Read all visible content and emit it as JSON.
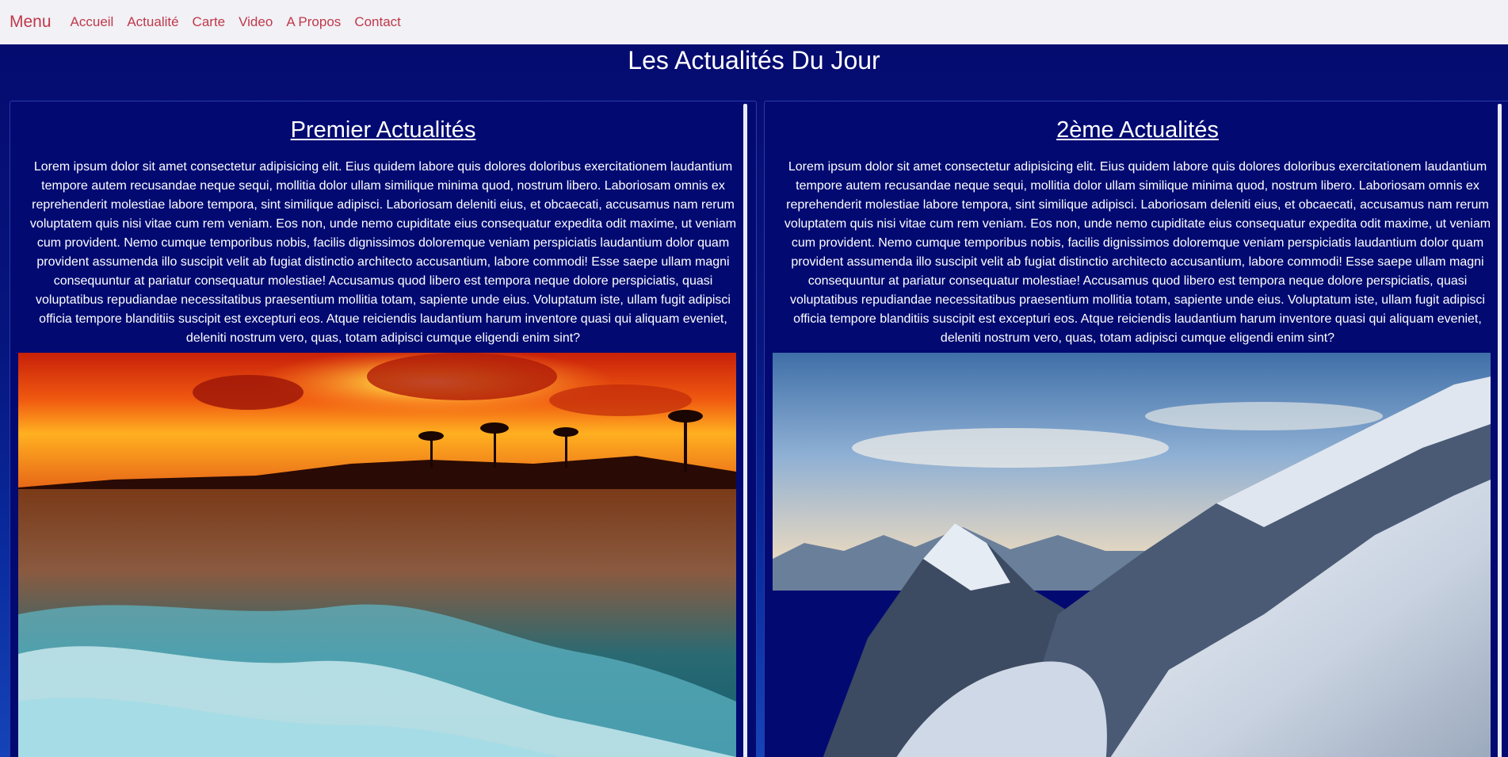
{
  "navbar": {
    "brand": "Menu",
    "links": [
      "Accueil",
      "Actualité",
      "Carte",
      "Video",
      "A Propos",
      "Contact"
    ],
    "link_color": "#c0394a",
    "background": "#f1f1f6"
  },
  "page": {
    "title": "Les Actualités Du Jour",
    "background": "#050a6e"
  },
  "articles": [
    {
      "title": "Premier Actualités",
      "text": "Lorem ipsum dolor sit amet consectetur adipisicing elit. Eius quidem labore quis dolores doloribus exercitationem laudantium tempore autem recusandae neque sequi, mollitia dolor ullam similique minima quod, nostrum libero. Laboriosam omnis ex reprehenderit molestiae labore tempora, sint similique adipisci. Laboriosam deleniti eius, et obcaecati, accusamus nam rerum voluptatem quis nisi vitae cum rem veniam. Eos non, unde nemo cupiditate eius consequatur expedita odit maxime, ut veniam cum provident. Nemo cumque temporibus nobis, facilis dignissimos doloremque veniam perspiciatis laudantium dolor quam provident assumenda illo suscipit velit ab fugiat distinctio architecto accusantium, labore commodi! Esse saepe ullam magni consequuntur at pariatur consequatur molestiae! Accusamus quod libero est tempora neque dolore perspiciatis, quasi voluptatibus repudiandae necessitatibus praesentium mollitia totam, sapiente unde eius. Voluptatum iste, ullam fugit adipisci officia tempore blanditiis suscipit est excepturi eos. Atque reiciendis laudantium harum inventore quasi qui aliquam eveniet, deleniti nostrum vero, quas, totam adipisci cumque eligendi enim sint?",
      "image": "sunset-beach-waves-photo"
    },
    {
      "title": "2ème Actualités",
      "text": "Lorem ipsum dolor sit amet consectetur adipisicing elit. Eius quidem labore quis dolores doloribus exercitationem laudantium tempore autem recusandae neque sequi, mollitia dolor ullam similique minima quod, nostrum libero. Laboriosam omnis ex reprehenderit molestiae labore tempora, sint similique adipisci. Laboriosam deleniti eius, et obcaecati, accusamus nam rerum voluptatem quis nisi vitae cum rem veniam. Eos non, unde nemo cupiditate eius consequatur expedita odit maxime, ut veniam cum provident. Nemo cumque temporibus nobis, facilis dignissimos doloremque veniam perspiciatis laudantium dolor quam provident assumenda illo suscipit velit ab fugiat distinctio architecto accusantium, labore commodi! Esse saepe ullam magni consequuntur at pariatur consequatur molestiae! Accusamus quod libero est tempora neque dolore perspiciatis, quasi voluptatibus repudiandae necessitatibus praesentium mollitia totam, sapiente unde eius. Voluptatum iste, ullam fugit adipisci officia tempore blanditiis suscipit est excepturi eos. Atque reiciendis laudantium harum inventore quasi qui aliquam eveniet, deleniti nostrum vero, quas, totam adipisci cumque eligendi enim sint?",
      "image": "snowy-mountains-photo"
    }
  ]
}
